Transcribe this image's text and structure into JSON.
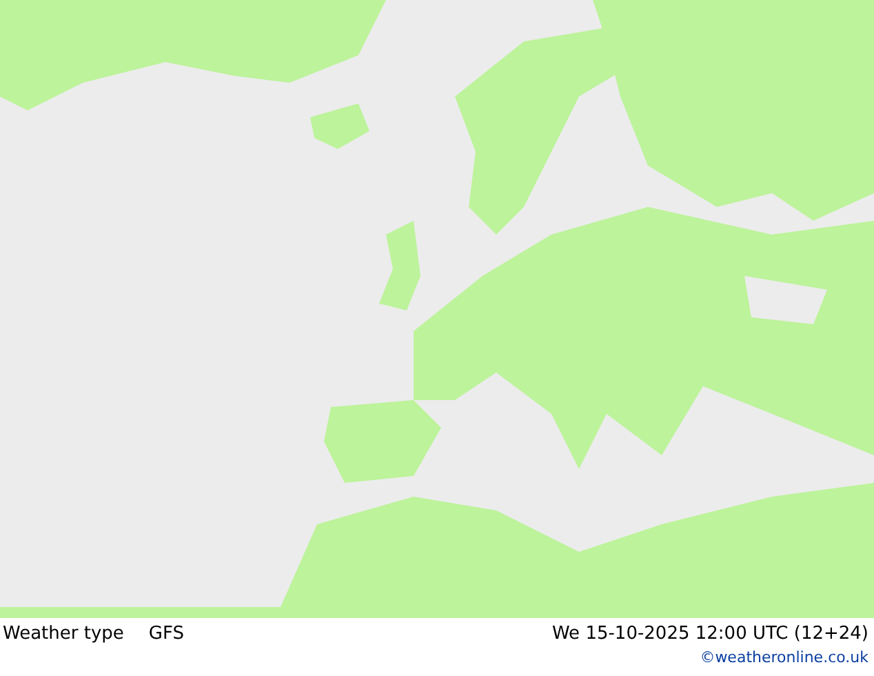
{
  "footer": {
    "title": "Weather type",
    "model": "GFS",
    "valid_time": "We 15-10-2025 12:00 UTC (12+24)",
    "credit": "©weatheronline.co.uk"
  }
}
